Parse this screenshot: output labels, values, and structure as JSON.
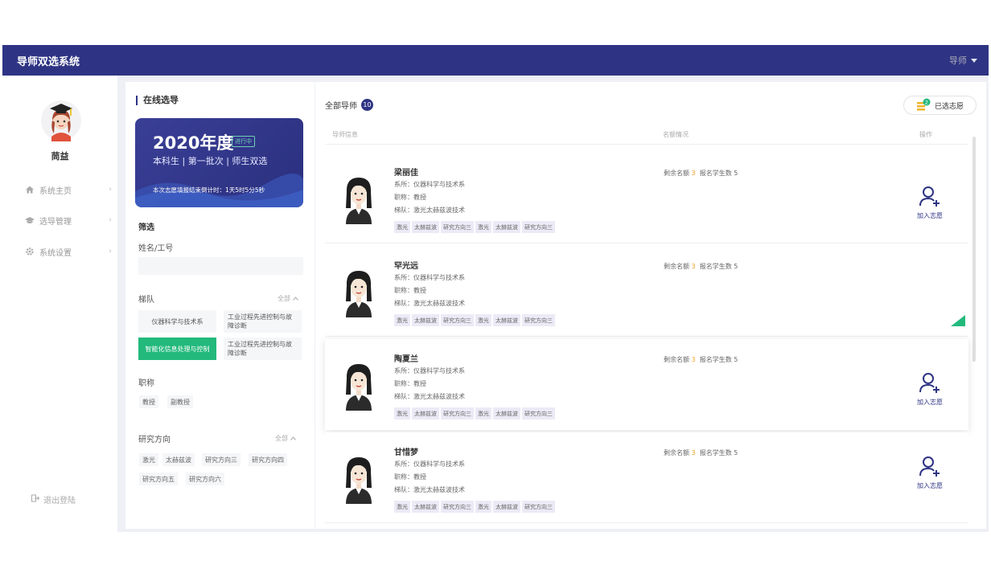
{
  "app": {
    "title": "导师双选系统",
    "user_menu": "导师"
  },
  "colors": {
    "primary": "#2e3483",
    "accent_green": "#23b97c",
    "quota_highlight": "#f0a020"
  },
  "sidebar": {
    "user_name": "茼益",
    "items": [
      {
        "label": "系统主页",
        "icon": "home-icon"
      },
      {
        "label": "选导管理",
        "icon": "graduation-cap-icon"
      },
      {
        "label": "系统设置",
        "icon": "gear-icon"
      }
    ],
    "logout": "退出登陆"
  },
  "filter": {
    "section_title": "在线选导",
    "banner": {
      "year": "2020年度",
      "status": "进行中",
      "subtitle": "本科生 | 第一批次 | 师生双选",
      "countdown": "本次志愿填报结束倒计时：1天5时5分5秒"
    },
    "heading": "筛选",
    "name_label": "姓名/工号",
    "name_value": "",
    "team_label": "梯队",
    "team_all": "全部",
    "teams": [
      {
        "label": "仪器科学与技术系",
        "active": false
      },
      {
        "label": "工业过程先进控制与故障诊断",
        "active": false
      },
      {
        "label": "智能化信息处理与控制",
        "active": true
      },
      {
        "label": "工业过程先进控制与故障诊断",
        "active": false
      }
    ],
    "title_label": "职称",
    "titles": [
      "教授",
      "副教授"
    ],
    "research_label": "研究方向",
    "research_all": "全部",
    "research": [
      "激光",
      "太赫兹波",
      "研究方向三",
      "研究方向四",
      "研究方向五",
      "研究方向六"
    ]
  },
  "main": {
    "all_label": "全部导师",
    "count": "10",
    "selected_label": "已选志愿",
    "selected_badge": "2",
    "columns": {
      "info": "导师信息",
      "quota": "名额情况",
      "action": "操作"
    },
    "join_label": "加入志愿",
    "teachers": [
      {
        "name": "梁丽佳",
        "dept": "系所：仪器科学与技术系",
        "title": "职称：教授",
        "team": "梯队：激光太赫兹波技术",
        "tags": [
          "激光",
          "太赫兹波",
          "研究方向三",
          "激光",
          "太赫兹波",
          "研究方向三"
        ],
        "quota_label": "剩余名额",
        "quota_num": "3",
        "applied_label": "报名学生数",
        "applied_num": "5"
      },
      {
        "name": "罕光远",
        "dept": "系所：仪器科学与技术系",
        "title": "职称：教授",
        "team": "梯队：激光太赫兹波技术",
        "tags": [
          "激光",
          "太赫兹波",
          "研究方向三",
          "激光",
          "太赫兹波",
          "研究方向三"
        ],
        "quota_label": "剩余名额",
        "quota_num": "3",
        "applied_label": "报名学生数",
        "applied_num": "5"
      },
      {
        "name": "陶夏兰",
        "dept": "系所：仪器科学与技术系",
        "title": "职称：教授",
        "team": "梯队：激光太赫兹波技术",
        "tags": [
          "激光",
          "太赫兹波",
          "研究方向三",
          "激光",
          "太赫兹波",
          "研究方向三"
        ],
        "quota_label": "剩余名额",
        "quota_num": "3",
        "applied_label": "报名学生数",
        "applied_num": "5"
      },
      {
        "name": "甘惜梦",
        "dept": "系所：仪器科学与技术系",
        "title": "职称：教授",
        "team": "梯队：激光太赫兹波技术",
        "tags": [
          "激光",
          "太赫兹波",
          "研究方向三",
          "激光",
          "太赫兹波",
          "研究方向三"
        ],
        "quota_label": "剩余名额",
        "quota_num": "3",
        "applied_label": "报名学生数",
        "applied_num": "5"
      }
    ]
  }
}
